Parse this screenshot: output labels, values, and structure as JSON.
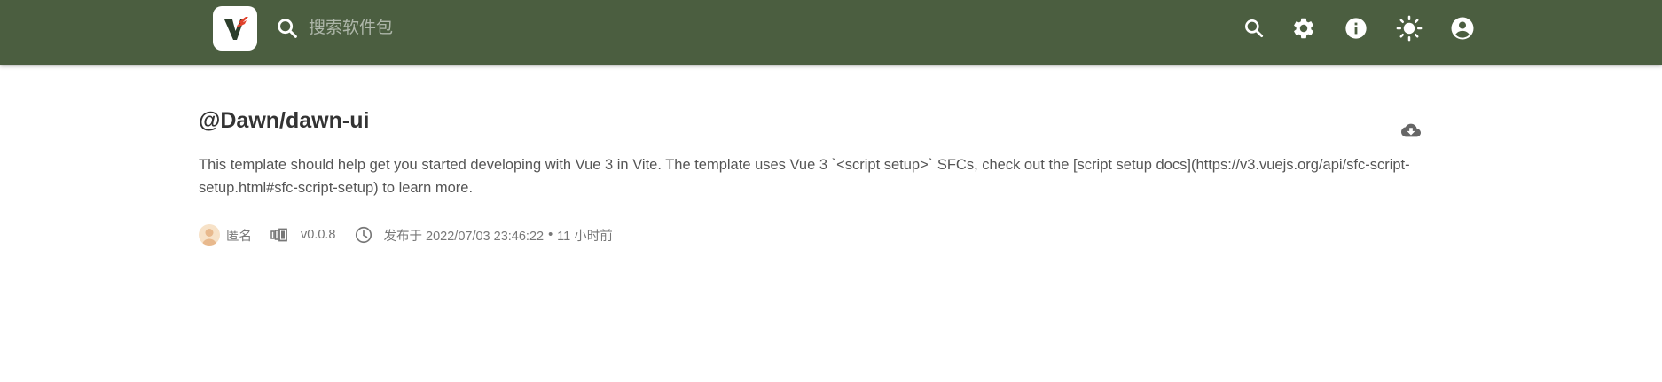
{
  "header": {
    "logo_letter": "V",
    "search_placeholder": "搜索软件包",
    "icons": [
      "search-icon",
      "settings-gear-icon",
      "info-icon",
      "brightness-icon",
      "account-circle-icon"
    ]
  },
  "package": {
    "name": "@Dawn/dawn-ui",
    "description": "This template should help get you started developing with Vue 3 in Vite. The template uses Vue 3 `<script setup>` SFCs, check out the [script setup docs](https://v3.vuejs.org/api/sfc-script-setup.html#sfc-script-setup) to learn more.",
    "author": "匿名",
    "version": "v0.0.8",
    "published_label": "发布于 2022/07/03 23:46:22",
    "separator": "•",
    "relative_time": "11 小时前"
  },
  "colors": {
    "header_bg": "#4b5e40",
    "logo_red": "#e2412b",
    "logo_dark": "#2c3e2b"
  }
}
